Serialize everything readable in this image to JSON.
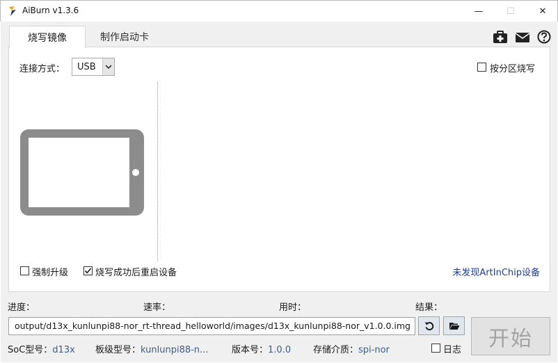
{
  "window": {
    "title": "AiBurn v1.3.6",
    "min_glyph": "—",
    "max_glyph": "☐",
    "close_glyph": "✕"
  },
  "tabs": [
    {
      "label": "烧写镜像",
      "active": true
    },
    {
      "label": "制作启动卡",
      "active": false
    }
  ],
  "toolbar_icons": [
    "first-aid-kit-icon",
    "mail-icon",
    "help-icon"
  ],
  "connection": {
    "label": "连接方式：",
    "value": "USB"
  },
  "partition_burn": {
    "label": "按分区烧写",
    "checked": false
  },
  "force_upgrade": {
    "label": "强制升级",
    "checked": false
  },
  "reboot_after": {
    "label": "烧写成功后重启设备",
    "checked": true
  },
  "device_status": "未发现ArtInChip设备",
  "progress": {
    "progress_label": "进度：",
    "rate_label": "速率：",
    "time_label": "用时：",
    "result_label": "结果："
  },
  "image_path": "output/d13x_kunlunpi88-nor_rt-thread_helloworld/images/d13x_kunlunpi88-nor_v1.0.0.img",
  "start_button": "开始",
  "info": {
    "soc_label": "SoC型号：",
    "soc_value": "d13x",
    "board_label": "板级型号：",
    "board_value": "kunlunpi88-n...",
    "version_label": "版本号：",
    "version_value": "1.0.0",
    "storage_label": "存储介质：",
    "storage_value": "spi-nor"
  },
  "log": {
    "label": "日志",
    "checked": false
  },
  "colors": {
    "link": "#1e3f8c",
    "info_value": "#3a5e8c",
    "device_gray": "#8c8c8c",
    "button_accent": "#1e3f8c"
  }
}
